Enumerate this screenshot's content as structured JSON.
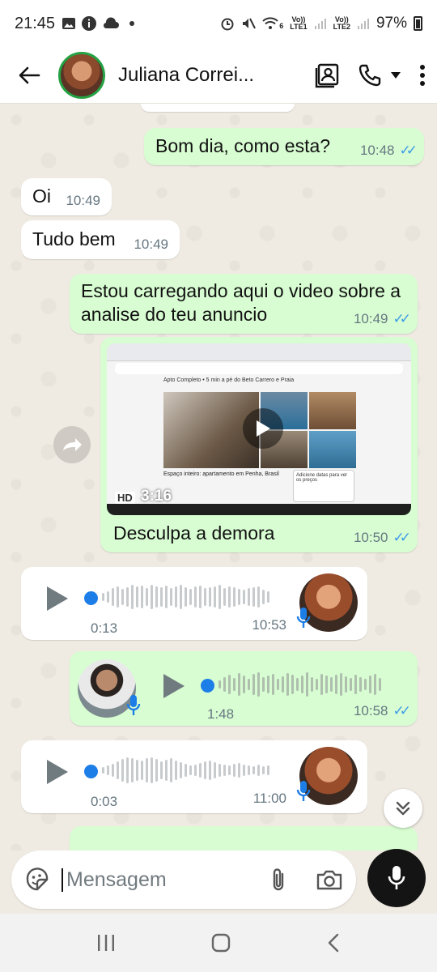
{
  "status_bar": {
    "time": "21:45",
    "carrier1": "Vo))",
    "carrier1_sub": "LTE1",
    "carrier2": "Vo))",
    "carrier2_sub": "LTE2",
    "wifi_badge": "6",
    "battery": "97%"
  },
  "header": {
    "contact_name": "Juliana Correi..."
  },
  "messages": [
    {
      "text": "Bom dia, como esta?",
      "time": "10:48"
    },
    {
      "text": "Oi",
      "time": "10:49"
    },
    {
      "text": "Tudo bem",
      "time": "10:49"
    },
    {
      "text": "Estou carregando aqui o video sobre a analise do teu anuncio",
      "time": "10:49"
    },
    {
      "caption": "Desculpa a demora",
      "time": "10:50",
      "video_duration": "3:16",
      "video_badge": "HD",
      "video_title": "Apto Completo • 5 min a pé do Beto Carrero e Praia",
      "video_text": "Espaço inteiro: apartamento em Penha, Brasil",
      "video_box": "Adicione datas para ver os preços"
    },
    {
      "voice_duration": "0:13",
      "time": "10:53",
      "progress": 0.0
    },
    {
      "voice_duration": "1:48",
      "time": "10:58",
      "progress": 0.0
    },
    {
      "voice_duration": "0:03",
      "time": "11:00",
      "progress": 0.0
    }
  ],
  "composer": {
    "placeholder": "Mensagem"
  },
  "icons": {
    "back": "arrow-left-icon",
    "contact_card": "contact-card-icon",
    "call": "phone-icon",
    "dropdown": "caret-down-icon",
    "menu": "more-vertical-icon",
    "emoji": "sticker-icon",
    "attach": "paperclip-icon",
    "camera": "camera-icon",
    "mic": "microphone-icon"
  },
  "colors": {
    "outgoing_bubble": "#d8fdd2",
    "incoming_bubble": "#ffffff",
    "read_ticks": "#3d9be9",
    "voice_dot": "#1c7ee6"
  }
}
